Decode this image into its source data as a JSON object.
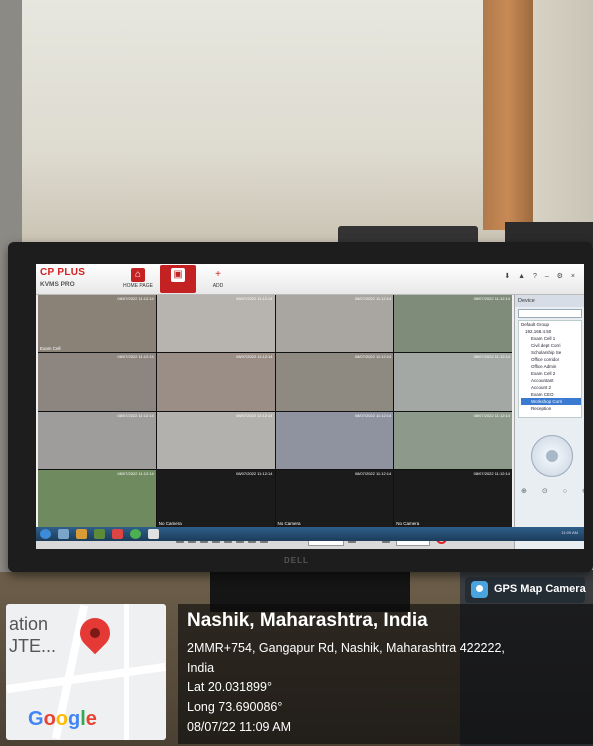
{
  "app": {
    "logo": "CP PLUS",
    "logo_sub": "KVMS PRO",
    "tabs": [
      {
        "label": "HOME PAGE",
        "active": false
      },
      {
        "label": "",
        "active": true
      },
      {
        "label": "ADD",
        "active": false
      }
    ],
    "header_icons": "⬇ ▲ ? – ⚙ ×"
  },
  "camera_grid": {
    "cells": [
      {
        "label": "Exam Cell",
        "color": "#8a8177"
      },
      {
        "label": "",
        "color": "#b7b3ae"
      },
      {
        "label": "",
        "color": "#a9a6a1"
      },
      {
        "label": "",
        "color": "#7f8c7a"
      },
      {
        "label": "",
        "color": "#8c8580"
      },
      {
        "label": "",
        "color": "#9a8e86"
      },
      {
        "label": "",
        "color": "#8e8a82"
      },
      {
        "label": "",
        "color": "#a3a8a4"
      },
      {
        "label": "",
        "color": "#9e9d9b"
      },
      {
        "label": "",
        "color": "#b3b1ad"
      },
      {
        "label": "",
        "color": "#8f93a0"
      },
      {
        "label": "",
        "color": "#8d998a"
      },
      {
        "label": "",
        "color": "#6f8a5e"
      },
      {
        "label": "No Camera",
        "color": "#1b1b1b"
      },
      {
        "label": "No Camera",
        "color": "#1b1b1b"
      },
      {
        "label": "No Camera",
        "color": "#1b1b1b"
      }
    ],
    "timestamp": "08/07/2022 11:12:14"
  },
  "sidebar": {
    "title": "Device",
    "tree": [
      {
        "label": "Default Group",
        "selected": false
      },
      {
        "label": "192.168.4.50",
        "selected": false
      },
      {
        "label": "Exam Cell 1",
        "selected": false
      },
      {
        "label": "Civil dept Corri",
        "selected": false
      },
      {
        "label": "Scholarship Se",
        "selected": false
      },
      {
        "label": "Office corridor",
        "selected": false
      },
      {
        "label": "Office Admin",
        "selected": false
      },
      {
        "label": "Exam Cell 2",
        "selected": false
      },
      {
        "label": "Accountant",
        "selected": false
      },
      {
        "label": "Account 2",
        "selected": false
      },
      {
        "label": "Exam CEO",
        "selected": false
      },
      {
        "label": "Workshop Corri",
        "selected": true
      },
      {
        "label": "Reception",
        "selected": false
      }
    ]
  },
  "toolbar": {
    "layout_select": "Full Mode",
    "stream_select": "None"
  },
  "monitor_brand": "DELL",
  "gps": {
    "badge": "GPS Map Camera",
    "place": "Nashik, Maharashtra, India",
    "address_line1": "2MMR+754, Gangapur Rd, Nashik, Maharashtra 422222,",
    "address_line2": "India",
    "lat": "Lat 20.031899°",
    "long": "Long 73.690086°",
    "datetime": "08/07/22 11:09 AM"
  },
  "map": {
    "text1": "ation",
    "text2": "JTE...",
    "google": "Google"
  }
}
